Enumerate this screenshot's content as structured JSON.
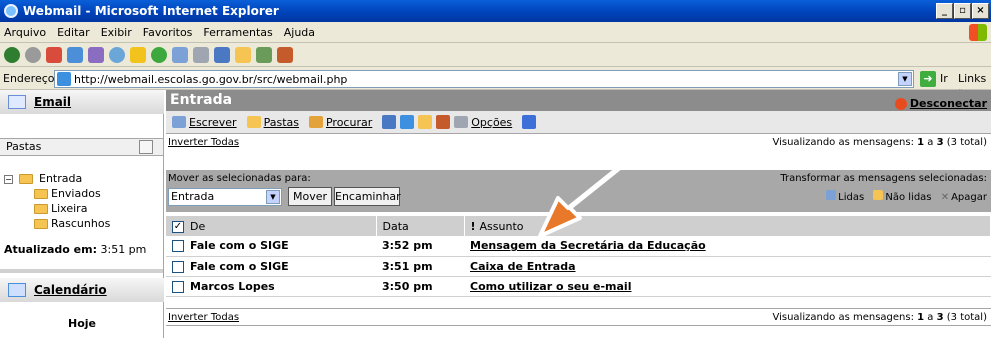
{
  "window": {
    "title": "Webmail - Microsoft Internet Explorer"
  },
  "menu": [
    "Arquivo",
    "Editar",
    "Exibir",
    "Favoritos",
    "Ferramentas",
    "Ajuda"
  ],
  "address": {
    "label": "Endereço",
    "url": "http://webmail.escolas.go.gov.br/src/webmail.php",
    "go": "Ir",
    "links": "Links"
  },
  "sidebar": {
    "email": "Email",
    "pastas": "Pastas",
    "folders": [
      "Entrada",
      "Enviados",
      "Lixeira",
      "Rascunhos"
    ],
    "updated_label": "Atualizado em:",
    "updated_time": "3:51 pm",
    "calendar": "Calendário",
    "today": "Hoje"
  },
  "main": {
    "title": "Entrada",
    "disconnect": "Desconectar",
    "actions": [
      "Escrever",
      "Pastas",
      "Procurar",
      "Opções"
    ],
    "invert": "Inverter Todas",
    "viewing": {
      "prefix": "Visualizando as mensagens: ",
      "from": "1",
      "to": "3",
      "total": "(3 total)",
      "sep": " a "
    },
    "move_label": "Mover as selecionadas para:",
    "transform_label": "Transformar as mensagens selecionadas:",
    "move_select": "Entrada",
    "move_btn": "Mover",
    "forward_btn": "Encaminhar",
    "read": "Lidas",
    "unread": "Não lidas",
    "delete": "Apagar",
    "columns": {
      "from": "De",
      "date": "Data",
      "subject": "Assunto"
    },
    "messages": [
      {
        "from": "Fale com o SIGE",
        "date": "3:52 pm",
        "subject": "Mensagem da Secretária da Educação"
      },
      {
        "from": "Fale com o SIGE",
        "date": "3:51 pm",
        "subject": "Caixa de Entrada"
      },
      {
        "from": "Marcos Lopes",
        "date": "3:50 pm",
        "subject": "Como utilizar o seu e-mail"
      }
    ]
  }
}
